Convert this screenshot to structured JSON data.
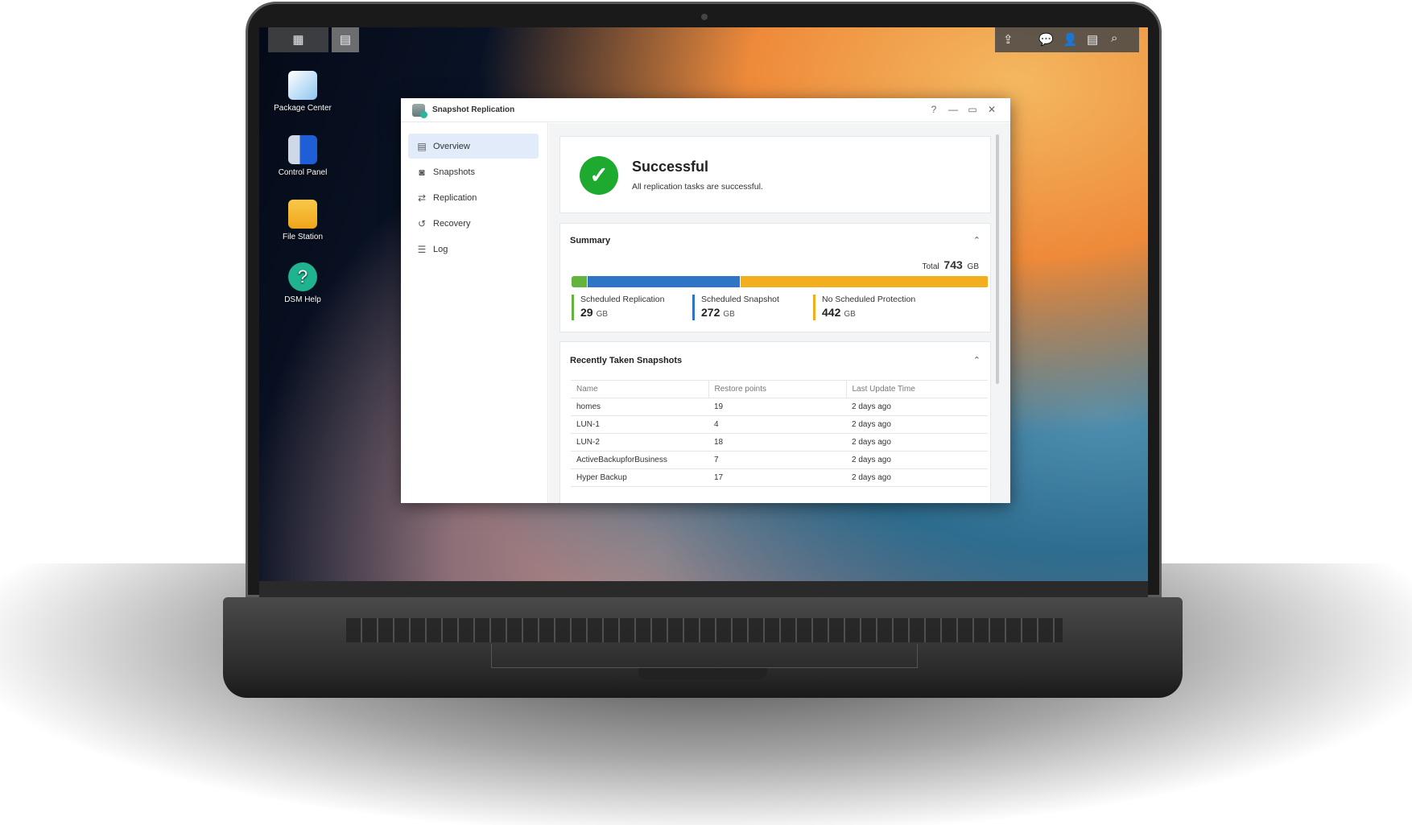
{
  "taskbar": {
    "left_icons": [
      "main-menu-icon",
      "snapshot-replication-app-icon"
    ],
    "right_icons": [
      "upload-icon",
      "notification-icon",
      "user-icon",
      "widgets-icon",
      "search-icon"
    ]
  },
  "desktop": [
    {
      "label": "Package Center",
      "icon": "package-center-icon"
    },
    {
      "label": "Control Panel",
      "icon": "control-panel-icon"
    },
    {
      "label": "File Station",
      "icon": "file-station-icon"
    },
    {
      "label": "DSM Help",
      "icon": "help-icon"
    }
  ],
  "window": {
    "title": "Snapshot Replication",
    "controls": [
      "?",
      "—",
      "▭",
      "✕"
    ]
  },
  "sidebar": {
    "items": [
      {
        "label": "Overview",
        "icon": "overview-icon"
      },
      {
        "label": "Snapshots",
        "icon": "camera-icon"
      },
      {
        "label": "Replication",
        "icon": "replication-icon"
      },
      {
        "label": "Recovery",
        "icon": "history-icon"
      },
      {
        "label": "Log",
        "icon": "list-icon"
      }
    ]
  },
  "status": {
    "title": "Successful",
    "message": "All replication tasks are successful."
  },
  "summary": {
    "title": "Summary",
    "total_label": "Total",
    "total_value": "743",
    "unit": "GB",
    "segments": [
      {
        "label": "Scheduled Replication",
        "value": "29",
        "gb": 29,
        "color": "#63b33d"
      },
      {
        "label": "Scheduled Snapshot",
        "value": "272",
        "gb": 272,
        "color": "#2f74c7"
      },
      {
        "label": "No Scheduled Protection",
        "value": "442",
        "gb": 442,
        "color": "#f2ae1c"
      }
    ]
  },
  "snapshots": {
    "title": "Recently Taken Snapshots",
    "columns": [
      "Name",
      "Restore points",
      "Last Update Time"
    ],
    "rows": [
      [
        "homes",
        "19",
        "2 days ago"
      ],
      [
        "LUN-1",
        "4",
        "2 days ago"
      ],
      [
        "LUN-2",
        "18",
        "2 days ago"
      ],
      [
        "ActiveBackupforBusiness",
        "7",
        "2 days ago"
      ],
      [
        "Hyper Backup",
        "17",
        "2 days ago"
      ]
    ]
  }
}
